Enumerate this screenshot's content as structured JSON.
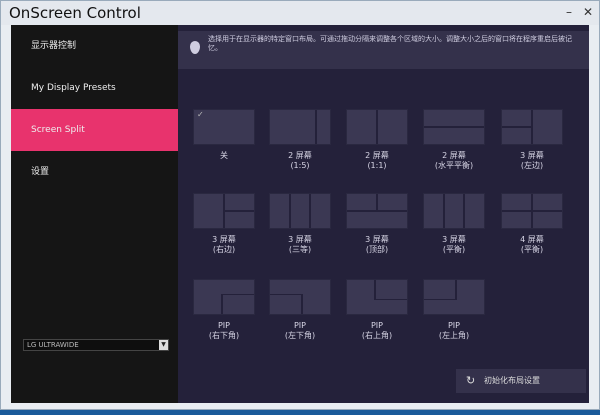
{
  "window": {
    "title": "OnScreen Control",
    "minimize": "–",
    "close": "✕"
  },
  "sidebar": {
    "items": [
      {
        "label": "显示器控制"
      },
      {
        "label": "My Display Presets"
      },
      {
        "label": "Screen Split"
      },
      {
        "label": "设置"
      }
    ],
    "active": 2,
    "monitor_select": "LG ULTRAWIDE"
  },
  "info": {
    "text": "选择用于在显示器的特定窗口布局。可通过拖动分隔来调整各个区域的大小。调整大小之后的窗口将在程序重启后被记忆。"
  },
  "layouts": [
    {
      "l1": "关",
      "l2": ""
    },
    {
      "l1": "2 屏幕",
      "l2": "(1:5)"
    },
    {
      "l1": "2 屏幕",
      "l2": "(1:1)"
    },
    {
      "l1": "2 屏幕",
      "l2": "(水平平衡)"
    },
    {
      "l1": "3 屏幕",
      "l2": "(左边)"
    },
    {
      "l1": "3 屏幕",
      "l2": "(右边)"
    },
    {
      "l1": "3 屏幕",
      "l2": "(三等)"
    },
    {
      "l1": "3 屏幕",
      "l2": "(顶部)"
    },
    {
      "l1": "3 屏幕",
      "l2": "(平衡)"
    },
    {
      "l1": "4 屏幕",
      "l2": "(平衡)"
    },
    {
      "l1": "PIP",
      "l2": "(右下角)"
    },
    {
      "l1": "PIP",
      "l2": "(左下角)"
    },
    {
      "l1": "PIP",
      "l2": "(右上角)"
    },
    {
      "l1": "PIP",
      "l2": "(左上角)"
    }
  ],
  "selected_layout": 0,
  "reset_button": "初始化布局设置",
  "colors": {
    "accent": "#e8336d",
    "main_bg": "#24213a",
    "sidebar_bg": "#151515"
  }
}
